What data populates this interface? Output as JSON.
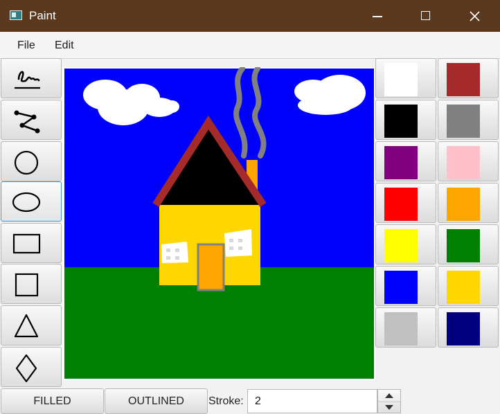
{
  "window": {
    "title": "Paint"
  },
  "menu": {
    "file": "File",
    "edit": "Edit"
  },
  "tools": [
    {
      "name": "freehand-icon"
    },
    {
      "name": "polyline-icon"
    },
    {
      "name": "circle-icon"
    },
    {
      "name": "ellipse-icon",
      "selected": true
    },
    {
      "name": "rectangle-icon"
    },
    {
      "name": "square-icon"
    },
    {
      "name": "triangle-icon"
    },
    {
      "name": "diamond-icon"
    }
  ],
  "palette": {
    "colors": [
      "#ffffff",
      "#a52a2a",
      "#000000",
      "#808080",
      "#800080",
      "#ffc0cb",
      "#ff0000",
      "#ffa500",
      "#ffff00",
      "#008000",
      "#0000ff",
      "#ffd700",
      "#c0c0c0",
      "#000080"
    ]
  },
  "canvas": {
    "sky_color": "#0000ff",
    "grass_color": "#008000",
    "house_color": "#ffd700",
    "roof_color": "#a52a2a",
    "door_color": "#ffa500",
    "smoke_color": "#808080"
  },
  "bottom": {
    "filled_label": "FILLED",
    "outlined_label": "OUTLINED",
    "stroke_label": "Stroke:",
    "stroke_value": "2"
  }
}
